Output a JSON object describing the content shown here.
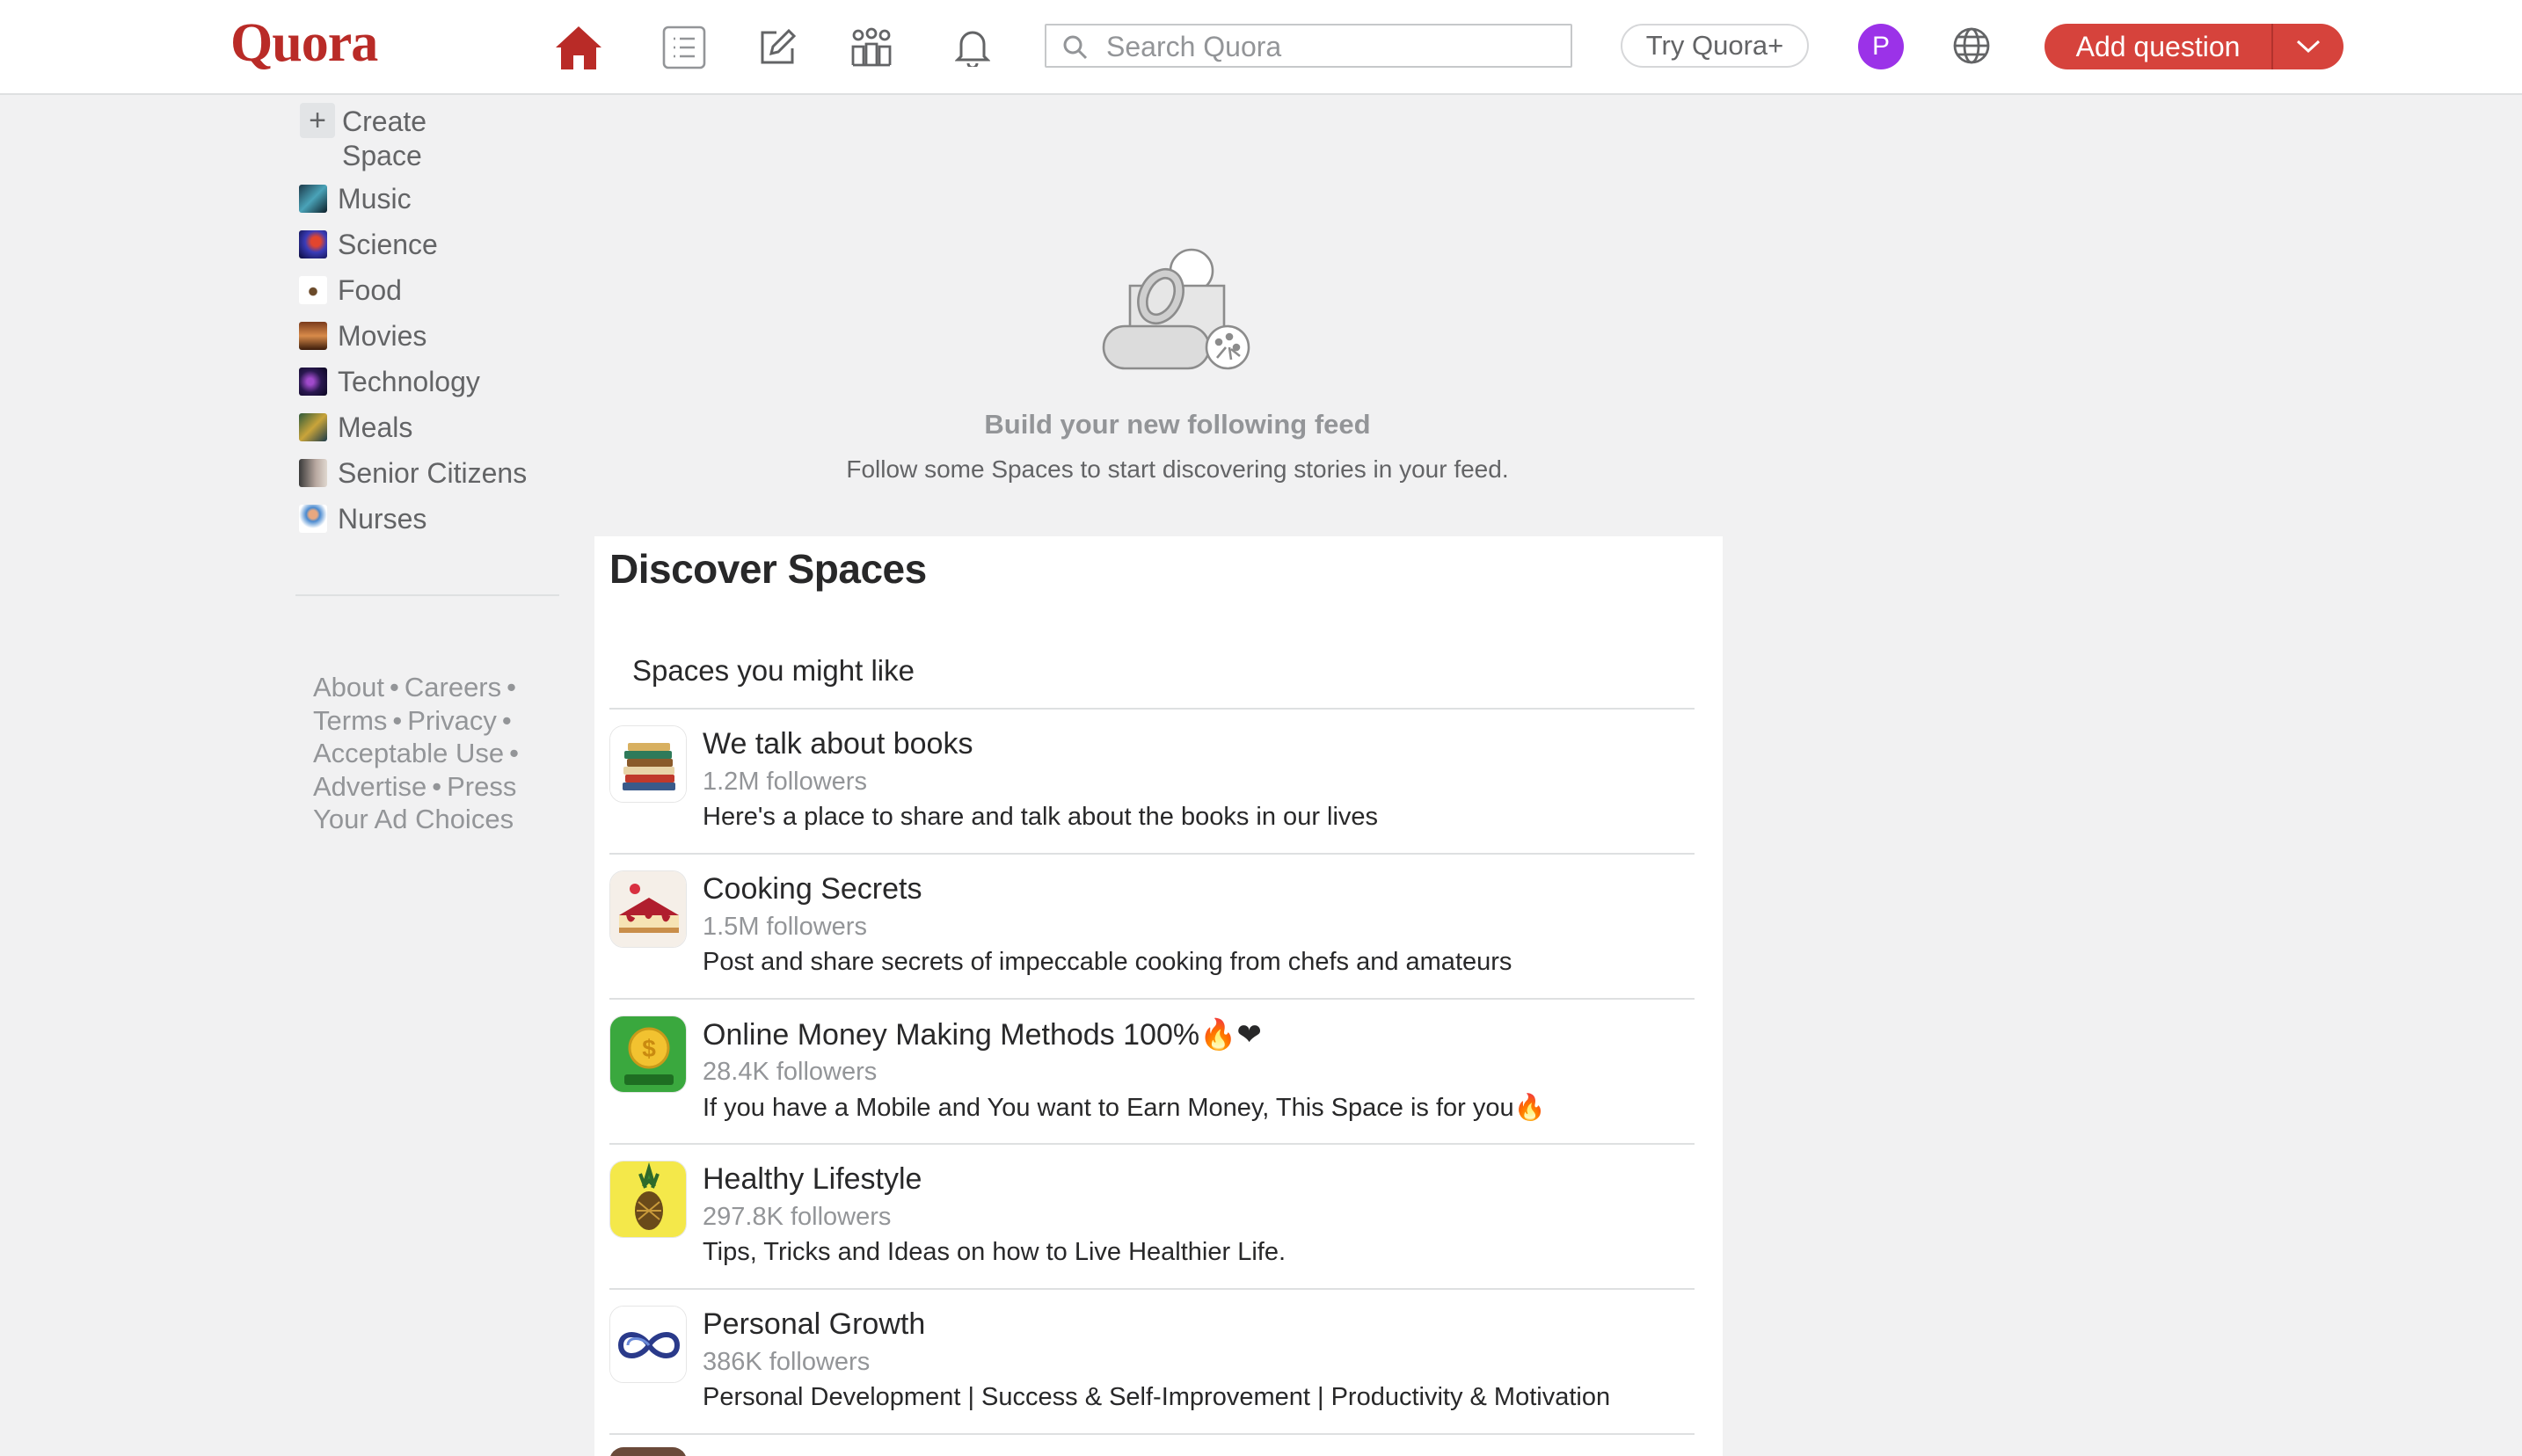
{
  "header": {
    "logo": "Quora",
    "nav": [
      "home-icon",
      "following-icon",
      "answer-icon",
      "spaces-icon",
      "notifications-icon"
    ],
    "search_placeholder": "Search Quora",
    "try_plus": "Try Quora+",
    "avatar_initial": "P",
    "add_question": "Add question",
    "brand_color": "#b92b27",
    "button_color": "#d6433c"
  },
  "sidebar": {
    "create_space": "Create Space",
    "items": [
      {
        "label": "Music",
        "icon": "music-thumb"
      },
      {
        "label": "Science",
        "icon": "science-thumb"
      },
      {
        "label": "Food",
        "icon": "food-thumb"
      },
      {
        "label": "Movies",
        "icon": "movies-thumb"
      },
      {
        "label": "Technology",
        "icon": "technology-thumb"
      },
      {
        "label": "Meals",
        "icon": "meals-thumb"
      },
      {
        "label": "Senior Citizens",
        "icon": "senior-citizens-thumb"
      },
      {
        "label": "Nurses",
        "icon": "nurses-thumb"
      }
    ],
    "footer": [
      "About",
      "Careers",
      "Terms",
      "Privacy",
      "Acceptable Use",
      "Advertise",
      "Press",
      "Your Ad Choices"
    ]
  },
  "feed": {
    "empty_title": "Build your new following feed",
    "empty_subtitle": "Follow some Spaces to start discovering stories in your feed."
  },
  "discover": {
    "title": "Discover Spaces",
    "subtitle": "Spaces you might like",
    "spaces": [
      {
        "name": "We talk about books",
        "followers": "1.2M followers",
        "description": "Here's a place to share and talk about the books in our lives",
        "icon": "books-icon"
      },
      {
        "name": "Cooking Secrets",
        "followers": "1.5M followers",
        "description": "Post and share secrets of impeccable cooking from chefs and amateurs",
        "icon": "cheesecake-icon"
      },
      {
        "name": "Online Money Making Methods 100%🔥❤",
        "followers": "28.4K followers",
        "description": "If you have a Mobile and You want to Earn Money, This Space is for you🔥",
        "icon": "money-coin-icon"
      },
      {
        "name": "Healthy Lifestyle",
        "followers": "297.8K followers",
        "description": "Tips, Tricks and Ideas on how to Live Healthier Life.",
        "icon": "pineapple-icon"
      },
      {
        "name": "Personal Growth",
        "followers": "386K followers",
        "description": "Personal Development | Success & Self-Improvement | Productivity & Motivation",
        "icon": "infinity-icon"
      }
    ]
  }
}
